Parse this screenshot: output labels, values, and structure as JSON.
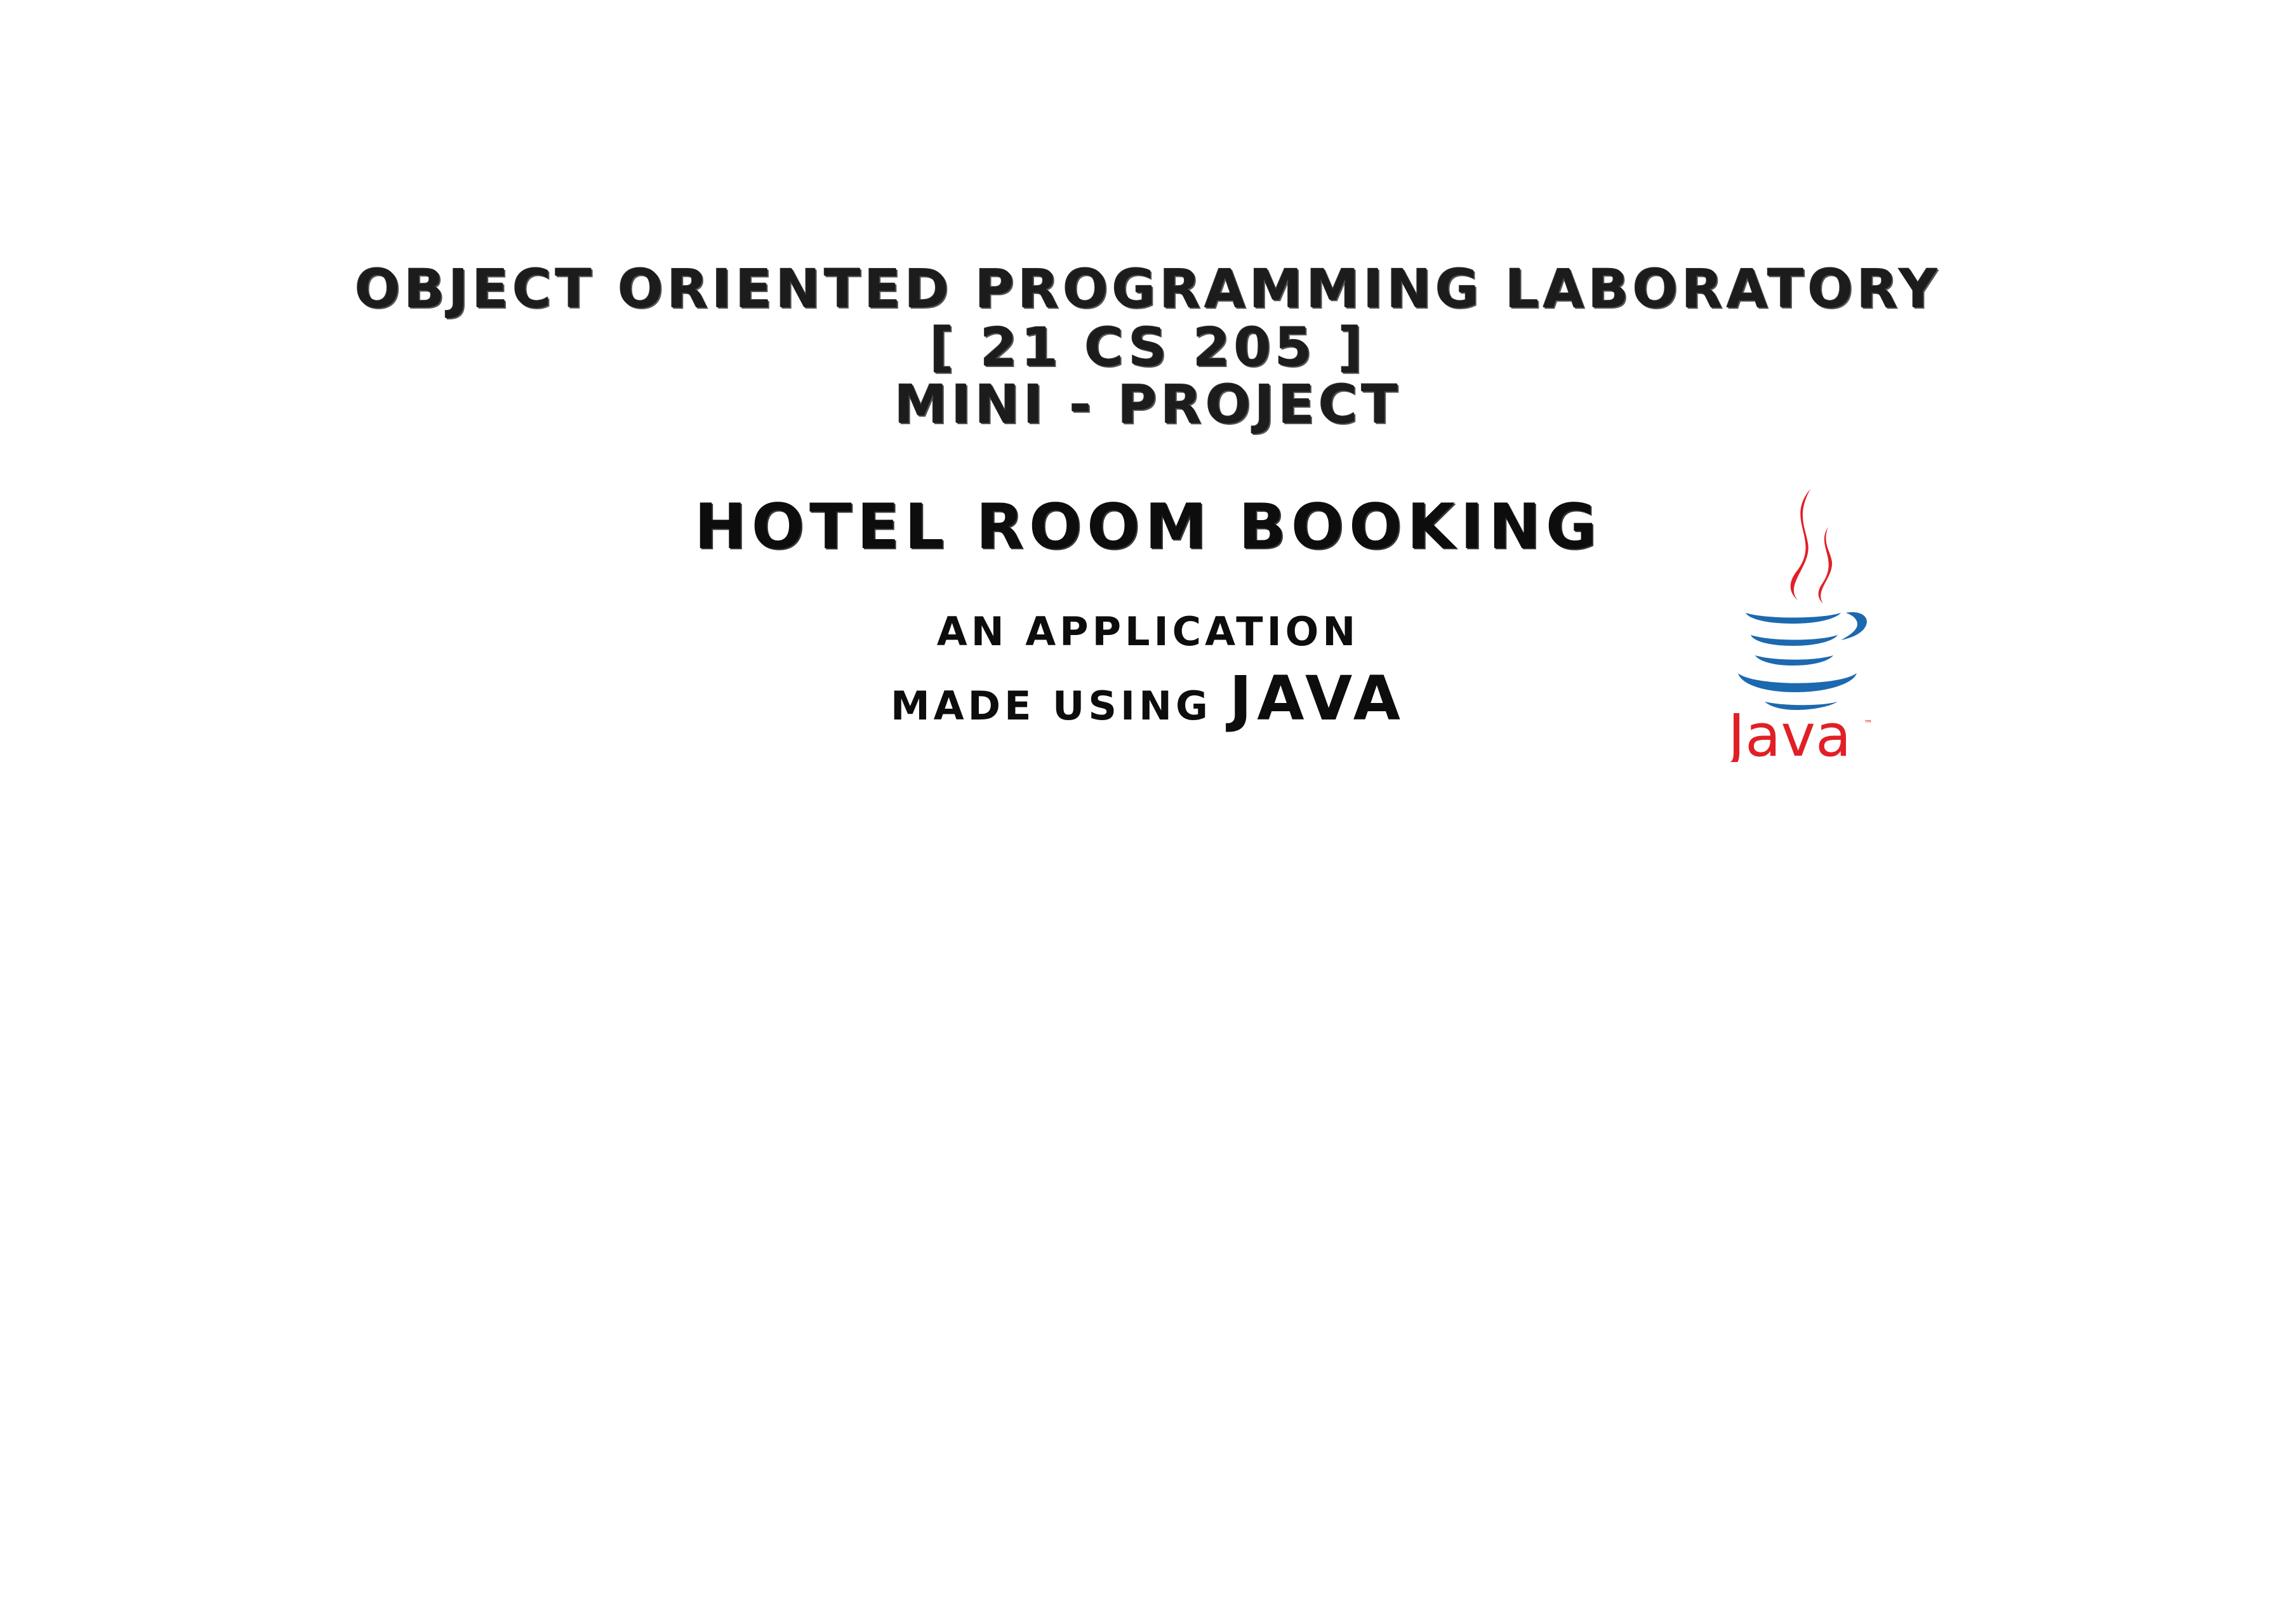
{
  "header": {
    "line1": "Object Oriented Programming Laboratory",
    "line2": "[ 21 CS 205 ]",
    "line3": "Mini - Project"
  },
  "title": "Hotel Room Booking",
  "subtitle": {
    "line1": "an Application",
    "line2_prefix": "made using ",
    "line2_emphasis": "Java"
  },
  "logo": {
    "icon": "java-coffee-cup-logo",
    "wordmark": "Java",
    "trademark": "™",
    "colors": {
      "steam": "#e11f26",
      "cup": "#1c69b0",
      "wordmark": "#e11f26"
    }
  }
}
